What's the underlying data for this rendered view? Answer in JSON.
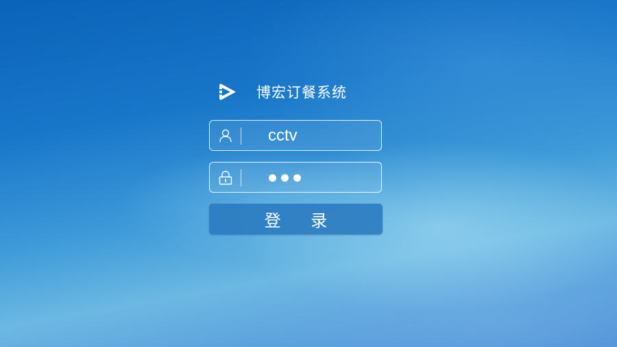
{
  "app": {
    "title": "博宏订餐系统",
    "logo_icon": "play-logo-icon"
  },
  "login": {
    "username": {
      "icon": "user-icon",
      "value": "cctv"
    },
    "password": {
      "icon": "lock-icon",
      "masked_length": 3
    },
    "submit_label": "登 录"
  },
  "colors": {
    "background_top": "#0a63b8",
    "background_bottom": "#6cb8e2",
    "button": "#2878be",
    "text": "#ffffff"
  }
}
